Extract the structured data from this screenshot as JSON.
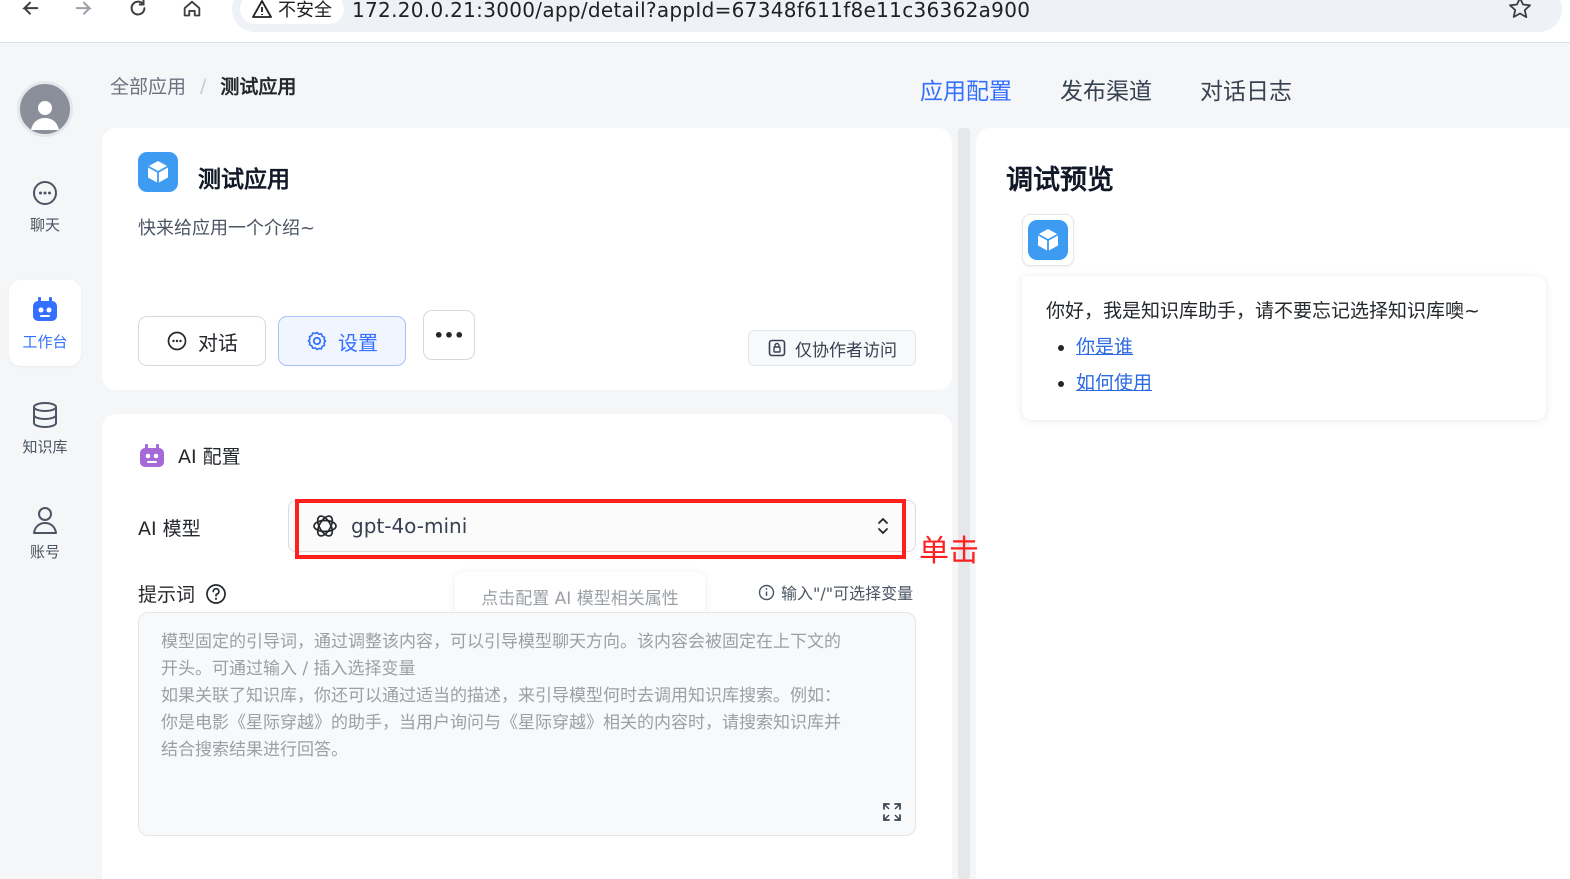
{
  "browser": {
    "insecure_label": "不安全",
    "url": "172.20.0.21:3000/app/detail?appId=67348f611f8e11c36362a900"
  },
  "sidenav": {
    "items": [
      {
        "label": "聊天"
      },
      {
        "label": "工作台"
      },
      {
        "label": "知识库"
      },
      {
        "label": "账号"
      }
    ]
  },
  "breadcrumb": {
    "root": "全部应用",
    "separator": "/",
    "current": "测试应用"
  },
  "tabs": [
    "应用配置",
    "发布渠道",
    "对话日志"
  ],
  "app": {
    "name": "测试应用",
    "description": "快来给应用一个介绍~",
    "chat_button": "对话",
    "settings_button": "设置",
    "more_button": "•••",
    "access_label": "仅协作者访问"
  },
  "ai_config": {
    "title": "AI 配置",
    "model_label": "AI 模型",
    "model_value": "gpt-4o-mini",
    "tooltip": "点击配置 AI 模型相关属性",
    "prompt_label": "提示词",
    "variable_hint": "输入\"/\"可选择变量",
    "prompt_placeholder_lines": [
      "模型固定的引导词，通过调整该内容，可以引导模型聊天方向。该内容会被固定在上下文的",
      "开头。可通过输入 / 插入选择变量",
      "如果关联了知识库，你还可以通过适当的描述，来引导模型何时去调用知识库搜索。例如：",
      "你是电影《星际穿越》的助手，当用户询问与《星际穿越》相关的内容时，请搜索知识库并",
      "结合搜索结果进行回答。"
    ]
  },
  "preview": {
    "title": "调试预览",
    "greeting": "你好，我是知识库助手，请不要忘记选择知识库噢~",
    "links": [
      "你是谁",
      "如何使用"
    ]
  },
  "annotation": {
    "text": "单击",
    "color": "#ff1f1f"
  },
  "colors": {
    "accent": "#3370ff",
    "app_icon": "#3e9bf2",
    "robot_purple": "#a66ad8"
  }
}
